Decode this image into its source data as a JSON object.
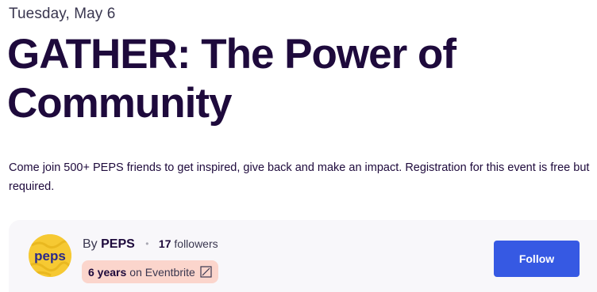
{
  "event": {
    "date": "Tuesday, May 6",
    "title": "GATHER: The Power of Community",
    "summary": "Come join 500+ PEPS friends to get inspired, give back and make an impact. Registration for this event is free but required."
  },
  "organizer": {
    "by_prefix": "By",
    "name": "PEPS",
    "followers_count": "17",
    "followers_label": "followers",
    "tenure_years": "6 years",
    "tenure_suffix": "on Eventbrite",
    "tenure_icon": "growth-chart-icon",
    "logo_text": "peps",
    "follow_label": "Follow"
  },
  "colors": {
    "title": "#1e0a3c",
    "follow_button": "#3659e3",
    "tenure_badge": "#fbd5cc",
    "card_background": "#f8f7fa",
    "logo_background": "#f6c933"
  }
}
